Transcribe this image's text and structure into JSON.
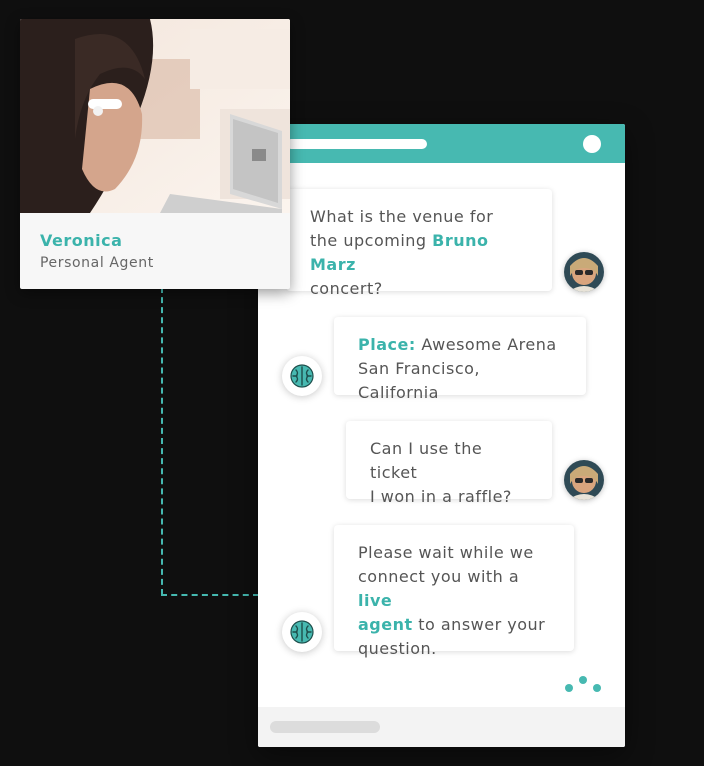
{
  "agent_card": {
    "name": "Veronica",
    "role": "Personal Agent",
    "photo": "woman-with-headset-at-laptop"
  },
  "chat": {
    "messages": [
      {
        "from": "user",
        "avatar": "user-avatar-sunglasses",
        "line1": "What is the venue for",
        "line2_prefix": "the upcoming ",
        "line2_highlight": "Bruno Marz",
        "line3": "concert?"
      },
      {
        "from": "bot",
        "avatar": "brain-icon",
        "label": "Place:",
        "line1_rest": " Awesome Arena",
        "line2": "San Francisco, California"
      },
      {
        "from": "user",
        "avatar": "user-avatar-sunglasses",
        "line1": "Can I use the ticket",
        "line2": "I won in a raffle?"
      },
      {
        "from": "bot",
        "avatar": "brain-icon",
        "line1": "Please wait while we",
        "line2_prefix": "connect you with a ",
        "line2_highlight": "live",
        "line3_highlight": "agent",
        "line3_suffix": " to answer your",
        "line4": "question."
      }
    ],
    "typing_indicator": "three-dots"
  },
  "colors": {
    "accent": "#47b9b1",
    "accent_text": "#3bb3ab",
    "background": "#0f0f0f",
    "bubble_text": "#555555"
  }
}
